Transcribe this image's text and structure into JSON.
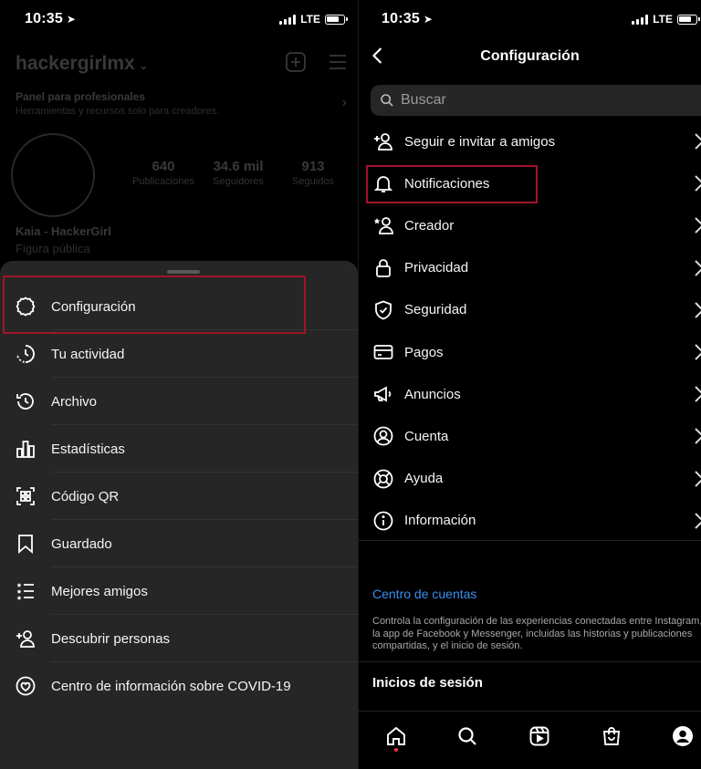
{
  "status_left": {
    "time": "10:35",
    "network": "LTE"
  },
  "status_right": {
    "time": "10:35",
    "network": "LTE"
  },
  "profile": {
    "username": "hackergirlmx",
    "pro_panel_title": "Panel para profesionales",
    "pro_panel_subtitle": "Herramientas y recursos solo para creadores.",
    "stats": [
      {
        "value": "640",
        "label": "Publicaciones"
      },
      {
        "value": "34.6 mil",
        "label": "Seguidores"
      },
      {
        "value": "913",
        "label": "Seguidos"
      }
    ],
    "display_name": "Kaia - HackerGirl",
    "category": "Figura pública"
  },
  "sheet": {
    "items": [
      {
        "label": "Configuración",
        "icon": "gear-icon"
      },
      {
        "label": "Tu actividad",
        "icon": "activity-icon"
      },
      {
        "label": "Archivo",
        "icon": "archive-icon"
      },
      {
        "label": "Estadísticas",
        "icon": "insights-icon"
      },
      {
        "label": "Código QR",
        "icon": "qr-code-icon"
      },
      {
        "label": "Guardado",
        "icon": "bookmark-icon"
      },
      {
        "label": "Mejores amigos",
        "icon": "close-friends-icon"
      },
      {
        "label": "Descubrir personas",
        "icon": "add-person-icon"
      },
      {
        "label": "Centro de información sobre COVID-19",
        "icon": "covid-info-icon"
      }
    ]
  },
  "settings": {
    "title": "Configuración",
    "search_placeholder": "Buscar",
    "items": [
      {
        "label": "Seguir e invitar a amigos",
        "icon": "add-person-icon"
      },
      {
        "label": "Notificaciones",
        "icon": "bell-icon"
      },
      {
        "label": "Creador",
        "icon": "creator-icon"
      },
      {
        "label": "Privacidad",
        "icon": "lock-icon"
      },
      {
        "label": "Seguridad",
        "icon": "shield-icon"
      },
      {
        "label": "Pagos",
        "icon": "card-icon"
      },
      {
        "label": "Anuncios",
        "icon": "megaphone-icon"
      },
      {
        "label": "Cuenta",
        "icon": "account-icon"
      },
      {
        "label": "Ayuda",
        "icon": "lifebuoy-icon"
      },
      {
        "label": "Información",
        "icon": "info-icon"
      }
    ],
    "accounts_center": "Centro de cuentas",
    "accounts_desc": "Controla la configuración de las experiencias conectadas entre Instagram, la app de Facebook y Messenger, incluidas las historias y publicaciones compartidas, y el inicio de sesión.",
    "logins": "Inicios de sesión"
  },
  "tabbar": [
    "home-icon",
    "search-icon",
    "reels-icon",
    "shop-icon",
    "profile-icon"
  ],
  "colors": {
    "highlight": "#a1142a",
    "link": "#3b8ef0",
    "sheet_bg": "#262626"
  }
}
